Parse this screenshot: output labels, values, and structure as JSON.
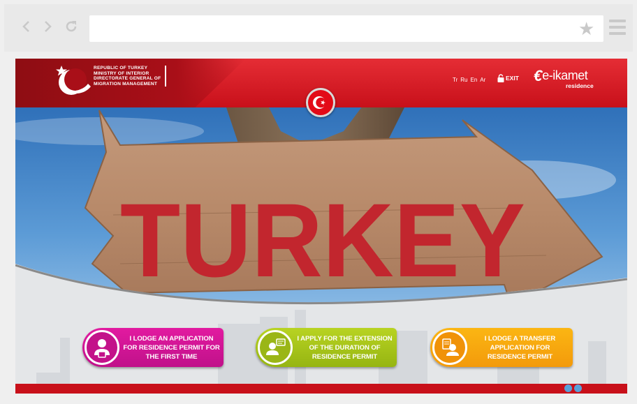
{
  "browser": {
    "back_icon": "chevron-left-icon",
    "forward_icon": "chevron-right-icon",
    "reload_icon": "reload-icon",
    "address": "",
    "bookmark_icon": "star-icon",
    "menu_icon": "hamburger-menu-icon"
  },
  "header": {
    "org_lines": [
      "REPUBLIC OF TURKEY",
      "MINISTRY OF INTERIOR",
      "DIRECTORATE GENERAL OF",
      "MIGRATION MANAGEMENT"
    ],
    "languages": [
      "Tr",
      "Ru",
      "En",
      "Ar"
    ],
    "exit_label": "EXIT",
    "brand_prefix": "e-",
    "brand_name": "ikamet",
    "brand_sub": "residence",
    "colors": {
      "primary": "#e52d35",
      "dark": "#8e0d13"
    }
  },
  "hero": {
    "sign_text": "TURKEY"
  },
  "actions": [
    {
      "label": "I LODGE AN APPLICATION FOR RESIDENCE PERMIT FOR THE FIRST TIME",
      "icon": "new-application-icon",
      "color": "#d5169a"
    },
    {
      "label": "I APPLY FOR THE EXTENSION OF THE DURATION OF RESIDENCE PERMIT",
      "icon": "extension-icon",
      "color": "#a8c41a"
    },
    {
      "label": "I LODGE A TRANSFER APPLICATION FOR RESIDENCE PERMIT",
      "icon": "transfer-icon",
      "color": "#f7a60e"
    }
  ]
}
